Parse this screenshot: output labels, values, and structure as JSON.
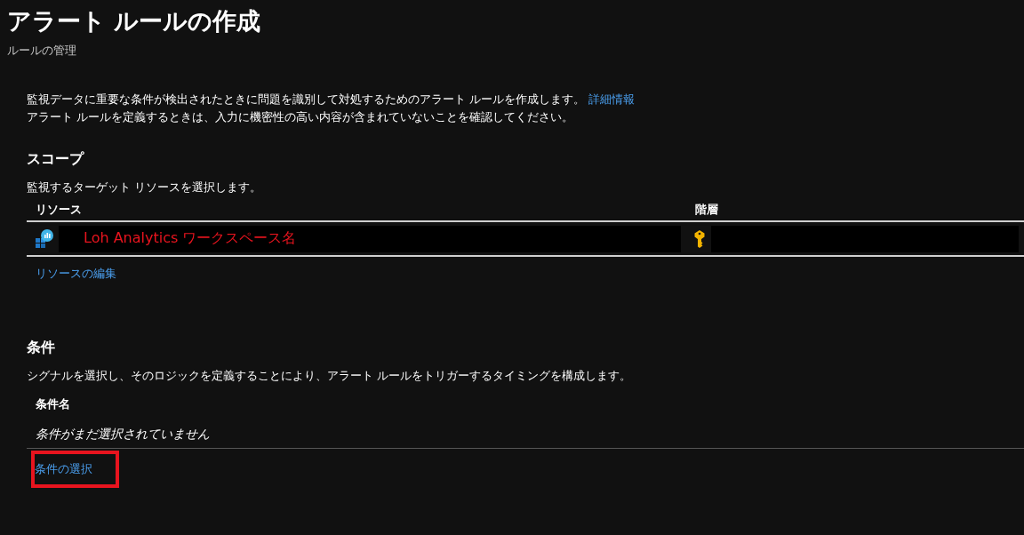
{
  "header": {
    "title": "アラート ルールの作成",
    "subtitle": "ルールの管理"
  },
  "intro": {
    "text": "監視データに重要な条件が検出されたときに問題を識別して対処するためのアラート ルールを作成します。",
    "link": "詳細情報",
    "note": "アラート ルールを定義するときは、入力に機密性の高い内容が含まれていないことを確認してください。"
  },
  "scope": {
    "heading": "スコープ",
    "description": "監視するターゲット リソースを選択します。",
    "columns": [
      "リソース",
      "階層"
    ],
    "resource": {
      "name": "Loh Analytics ワークスペース名",
      "redacted": true
    },
    "hierarchy": {
      "redacted": true
    },
    "edit_link": "リソースの編集"
  },
  "condition": {
    "heading": "条件",
    "description": "シグナルを選択し、そのロジックを定義することにより、アラート ルールをトリガーするタイミングを構成します。",
    "column": "条件名",
    "empty_text": "条件がまだ選択されていません",
    "select_link": "条件の選択",
    "highlighted": true
  }
}
